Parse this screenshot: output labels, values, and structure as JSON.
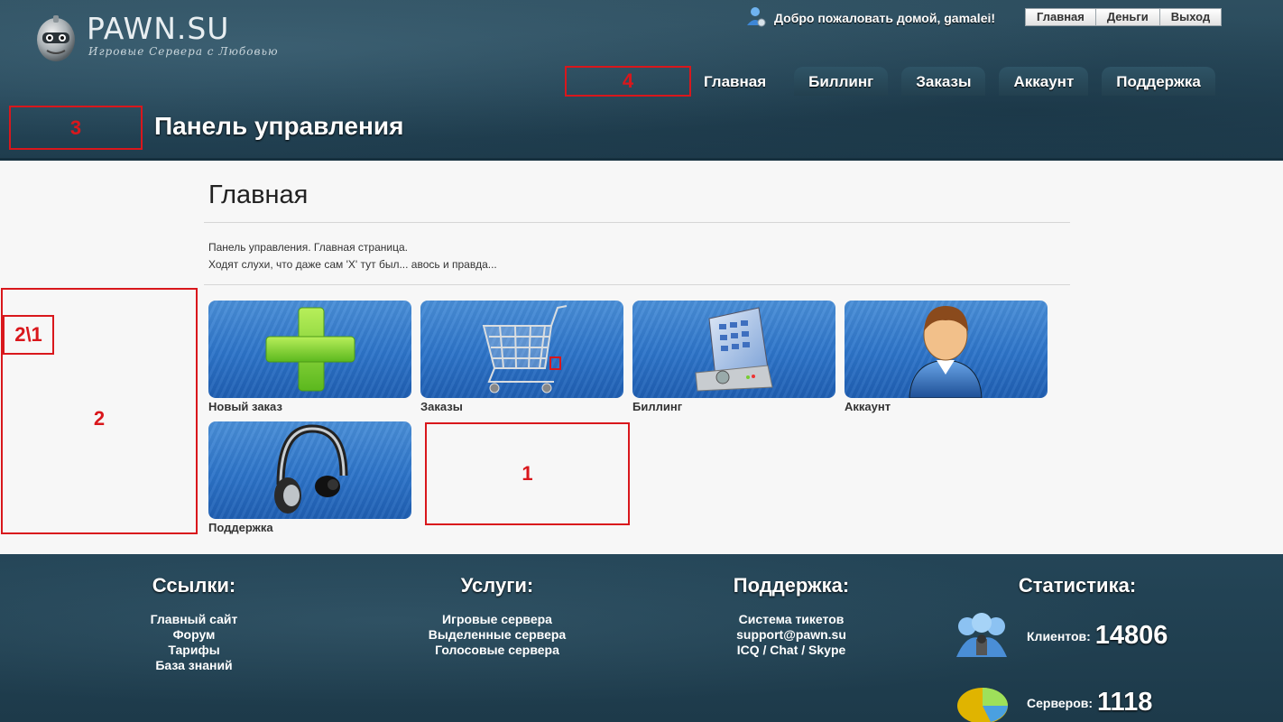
{
  "header": {
    "logo_title": "PAWN.SU",
    "logo_subtitle": "Игровые Сервера с Любовью",
    "welcome": "Добро пожаловать домой, gamalei!",
    "top_links": [
      "Главная",
      "Деньги",
      "Выход"
    ],
    "nav_tabs": [
      "Главная",
      "Биллинг",
      "Заказы",
      "Аккаунт",
      "Поддержка"
    ],
    "active_tab": "Главная",
    "page_title": "Панель управления"
  },
  "annotations": [
    "4",
    "3",
    "2\\1",
    "2",
    "1"
  ],
  "main": {
    "heading": "Главная",
    "intro_line1": "Панель управления. Главная страница.",
    "intro_line2": "Ходят слухи, что даже сам 'X' тут был... авось и правда...",
    "tiles": [
      {
        "label": "Новый заказ",
        "icon": "plus-icon"
      },
      {
        "label": "Заказы",
        "icon": "shopping-cart-icon"
      },
      {
        "label": "Биллинг",
        "icon": "billing-terminal-icon"
      },
      {
        "label": "Аккаунт",
        "icon": "user-icon"
      },
      {
        "label": "Поддержка",
        "icon": "headphones-icon"
      }
    ]
  },
  "footer": {
    "links": {
      "title": "Ссылки:",
      "items": [
        "Главный сайт",
        "Форум",
        "Тарифы",
        "База знаний"
      ]
    },
    "services": {
      "title": "Услуги:",
      "items": [
        "Игровые сервера",
        "Выделенные сервера",
        "Голосовые сервера"
      ]
    },
    "support": {
      "title": "Поддержка:",
      "items": [
        "Система тикетов",
        "support@pawn.su",
        "ICQ / Chat / Skype"
      ]
    },
    "stats": {
      "title": "Статистика:",
      "clients_label": "Клиентов:",
      "clients_value": "14806",
      "servers_label": "Серверов:",
      "servers_value": "1118"
    }
  },
  "colors": {
    "annotation": "#d9171c",
    "header_bg": "#27485a",
    "tile_blue": "#2d74c9"
  }
}
